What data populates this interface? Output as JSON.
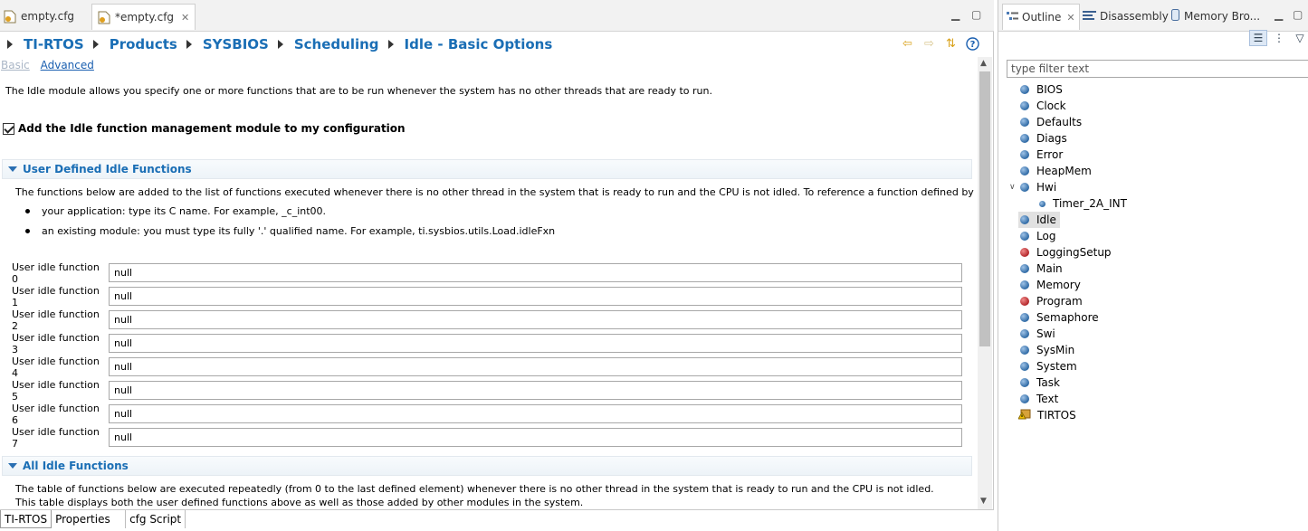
{
  "editor": {
    "tabs": [
      {
        "label": "empty.cfg"
      },
      {
        "label": "*empty.cfg",
        "close": "✕"
      }
    ],
    "breadcrumbs": [
      "TI-RTOS",
      "Products",
      "SYSBIOS",
      "Scheduling",
      "Idle - Basic Options"
    ],
    "modes": {
      "basic": "Basic",
      "advanced": "Advanced"
    },
    "description": "The Idle module allows you specify one or more functions that are to be run whenever the system has no other threads that are ready to run.",
    "checkbox_label": "Add the Idle function management module to my configuration",
    "checkbox_checked": true,
    "section1": {
      "title": "User Defined Idle Functions",
      "text": "The functions below are added to the list of functions executed whenever there is no other thread in the system that is ready to run and the CPU is not idled. To reference a function defined by",
      "bullets": [
        "your application: type its C name. For example, _c_int00.",
        "an existing module: you must type its fully '.' qualified name. For example, ti.sysbios.utils.Load.idleFxn"
      ],
      "functions": [
        {
          "label": "User idle function 0",
          "value": "null"
        },
        {
          "label": "User idle function 1",
          "value": "null"
        },
        {
          "label": "User idle function 2",
          "value": "null"
        },
        {
          "label": "User idle function 3",
          "value": "null"
        },
        {
          "label": "User idle function 4",
          "value": "null"
        },
        {
          "label": "User idle function 5",
          "value": "null"
        },
        {
          "label": "User idle function 6",
          "value": "null"
        },
        {
          "label": "User idle function 7",
          "value": "null"
        }
      ]
    },
    "section2": {
      "title": "All Idle Functions",
      "text": "The table of functions below are executed repeatedly (from 0 to the last defined element) whenever there is no other thread in the system that is ready to run and the CPU is not idled. This table displays both the user defined functions above as well as those added by other modules in the system."
    },
    "bottom_tabs": [
      "TI-RTOS",
      "Properties",
      "cfg Script"
    ]
  },
  "outline": {
    "tabs": [
      {
        "label": "Outline",
        "close": "✕"
      },
      {
        "label": "Disassembly"
      },
      {
        "label": "Memory Bro..."
      }
    ],
    "filter_placeholder": "type filter text",
    "items": [
      {
        "label": "BIOS",
        "icon": "blue-module"
      },
      {
        "label": "Clock",
        "icon": "blue-module"
      },
      {
        "label": "Defaults",
        "icon": "blue-module"
      },
      {
        "label": "Diags",
        "icon": "blue-module"
      },
      {
        "label": "Error",
        "icon": "blue-module"
      },
      {
        "label": "HeapMem",
        "icon": "blue-module"
      },
      {
        "label": "Hwi",
        "icon": "blue-module",
        "expanded": true
      },
      {
        "label": "Timer_2A_INT",
        "icon": "instance",
        "child": true
      },
      {
        "label": "Idle",
        "icon": "blue-module",
        "selected": true
      },
      {
        "label": "Log",
        "icon": "blue-module"
      },
      {
        "label": "LoggingSetup",
        "icon": "red-module"
      },
      {
        "label": "Main",
        "icon": "blue-module"
      },
      {
        "label": "Memory",
        "icon": "blue-module"
      },
      {
        "label": "Program",
        "icon": "red-module"
      },
      {
        "label": "Semaphore",
        "icon": "blue-module"
      },
      {
        "label": "Swi",
        "icon": "blue-module"
      },
      {
        "label": "SysMin",
        "icon": "blue-module"
      },
      {
        "label": "System",
        "icon": "blue-module"
      },
      {
        "label": "Task",
        "icon": "blue-module"
      },
      {
        "label": "Text",
        "icon": "blue-module"
      },
      {
        "label": "TIRTOS",
        "icon": "warning-package"
      }
    ]
  }
}
